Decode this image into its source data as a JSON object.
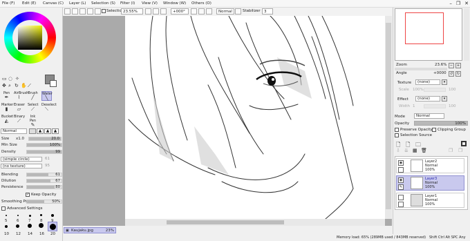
{
  "menu": {
    "items": [
      "File (F)",
      "Edit (E)",
      "Canvas (C)",
      "Layer (L)",
      "Selection (S)",
      "Filter (I)",
      "View (V)",
      "Window (W)",
      "Others (O)"
    ]
  },
  "window_controls": {
    "minimize": "–",
    "restore": "❐",
    "close": "✕"
  },
  "toolbar": {
    "selection_label": "Selection",
    "zoom": "23.55%",
    "rotation": "+000°",
    "mode": "Normal",
    "stabilizer_label": "Stabilizer",
    "stabilizer_value": "3"
  },
  "tools": {
    "row1": [
      "Pen",
      "AirBrush",
      "Brush",
      "Water"
    ],
    "row2": [
      "Marker",
      "Eraser",
      "Select",
      "Deselect"
    ],
    "row3": [
      "Bucket",
      "Binary",
      "Ink Pen"
    ]
  },
  "brush": {
    "blend_mode": "Normal",
    "size_label": "Size",
    "size_mult": "x1.0",
    "size_value": "20.0",
    "min_size_label": "Min Size",
    "min_size_value": "100%",
    "density_label": "Density",
    "density_value": "99",
    "shape": "(simple circle)",
    "shape_value": "61",
    "texture": "(no texture)",
    "texture_value": "95",
    "blending_label": "Blending",
    "blending_value": "61",
    "dilution_label": "Dilution",
    "dilution_value": "67",
    "persistence_label": "Persistence",
    "persistence_value": "80",
    "keep_opacity_label": "Keep Opacity",
    "smoothing_label": "Smoothing Pre",
    "smoothing_value": "50%",
    "advanced_label": "Advanced Settings",
    "dot_sizes_row1": [
      "5",
      "6",
      "7",
      "8",
      "9"
    ],
    "dot_sizes_row2": [
      "10",
      "12",
      "14",
      "16",
      "20"
    ]
  },
  "navigator": {
    "zoom_label": "Zoom",
    "zoom_value": "23.6%",
    "angle_label": "Angle",
    "angle_value": "+0000"
  },
  "layer_props": {
    "texture_label": "Texture",
    "texture_value": "(none)",
    "scale_label": "Scale",
    "scale_value": "100%",
    "strength_label": "Strength",
    "strength_value": "100",
    "effect_label": "Effect",
    "effect_value": "(none)",
    "width_label": "Width",
    "width_value": "1",
    "width_num": "100",
    "mode_label": "Mode",
    "mode_value": "Normal",
    "opacity_label": "Opacity",
    "opacity_value": "100%",
    "preserve_label": "Preserve Opacity",
    "clipping_label": "Clipping Group",
    "selsource_label": "Selection Source"
  },
  "layers": [
    {
      "name": "Layer2",
      "mode": "Normal",
      "opacity": "100%"
    },
    {
      "name": "Layer3",
      "mode": "Normal",
      "opacity": "100%"
    },
    {
      "name": "Layer1",
      "mode": "Normal",
      "opacity": "100%"
    }
  ],
  "document_tab": {
    "name": "Kaujaku.jpg",
    "zoom": "23%"
  },
  "status": {
    "memory": "Memory load: 65% (289MB used / 843MB reserved)",
    "keys": "Shift  Ctrl  Alt  SPC  Any"
  },
  "colors": {
    "accent": "#c9c9ee",
    "panel": "#f0f0f0",
    "canvas_bg": "#aaaaaa"
  }
}
